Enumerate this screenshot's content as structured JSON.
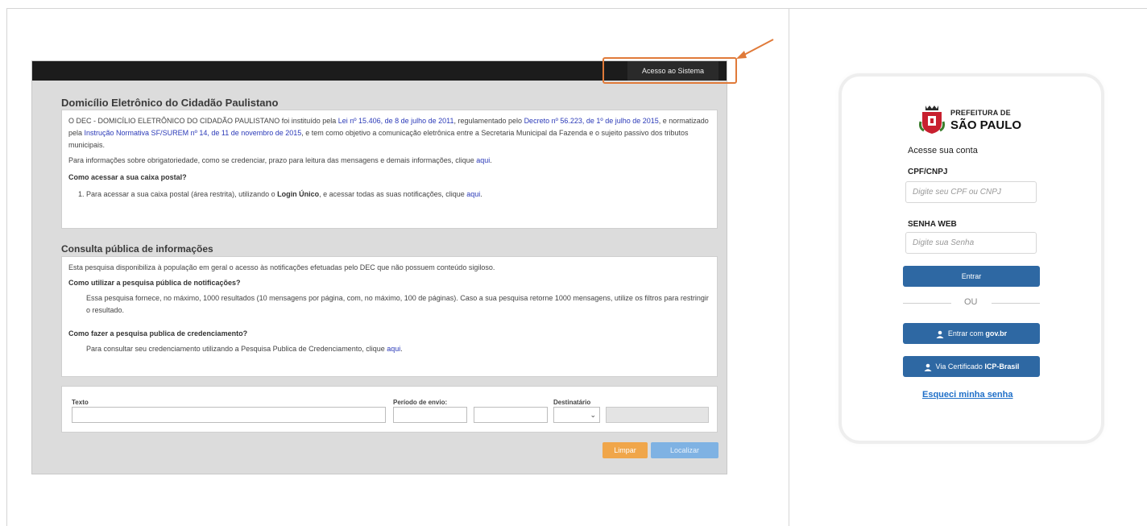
{
  "dec": {
    "access_button": "Acesso ao Sistema",
    "section1_title": "Domicílio Eletrônico do Cidadão Paulistano",
    "intro": {
      "t1": "O DEC - DOMICÍLIO ELETRÔNICO DO CIDADÃO PAULISTANO foi instituído pela ",
      "l1": "Lei nº 15.406, de 8 de julho de 2011",
      "t2": ", regulamentado pelo ",
      "l2": "Decreto nº 56.223, de 1º de julho de 2015",
      "t3": ", e normatizado pela ",
      "l3": "Instrução Normativa SF/SUREM nº 14, de 11 de novembro de 2015",
      "t4": ", e tem como objetivo a comunicação eletrônica entre a Secretaria Municipal da Fazenda e o sujeito passivo dos tributos municipais."
    },
    "info_text": "Para informações sobre obrigatoriedade, como se credenciar, prazo para leitura das mensagens e demais informações, clique ",
    "link_aqui": "aqui",
    "q1": "Como acessar a sua caixa postal?",
    "step1_a": "1. Para acessar a sua caixa postal (área restrita), utilizando o ",
    "step1_bold": "Login Único",
    "step1_b": ", e acessar todas as suas notificações, clique ",
    "section2_title": "Consulta pública de informações",
    "consulta_text": "Esta pesquisa disponibiliza à população em geral o acesso às notificações efetuadas pelo DEC que não possuem conteúdo sigiloso.",
    "q2": "Como utilizar a pesquisa pública de notificações?",
    "q2_text": "Essa pesquisa fornece, no máximo, 1000 resultados (10 mensagens por página, com, no máximo, 100 de páginas). Caso a sua pesquisa retorne 1000 mensagens, utilize os filtros para restringir o resultado.",
    "q3": "Como fazer a pesquisa publica de credenciamento?",
    "q3_text": "Para consultar seu credenciamento utilizando a Pesquisa Publica de Credenciamento, clique ",
    "form": {
      "texto_label": "Texto",
      "periodo_label": "Período de envio:",
      "destinatario_label": "Destinatário",
      "select_caret": "⌄"
    },
    "limpar": "Limpar",
    "localizar": "Localizar"
  },
  "login": {
    "brand_line1": "PREFEITURA DE",
    "brand_line2": "SÃO PAULO",
    "heading": "Acesse sua conta",
    "cpf_label": "CPF/CNPJ",
    "cpf_placeholder": "Digite seu CPF ou CNPJ",
    "senha_label": "SENHA WEB",
    "senha_placeholder": "Digite sua Senha",
    "entrar": "Entrar",
    "ou": "OU",
    "govbr_prefix": "Entrar com ",
    "govbr_bold": "gov.br",
    "cert_prefix": "Via Certificado ",
    "cert_bold": "ICP-Brasil",
    "forgot": "Esqueci minha senha"
  },
  "colors": {
    "accent_orange": "#e07a39",
    "login_blue": "#2e68a3",
    "link_blue": "#2b3ab8",
    "limpar_bg": "#f0a64a",
    "localizar_bg": "#7fb2e3"
  }
}
